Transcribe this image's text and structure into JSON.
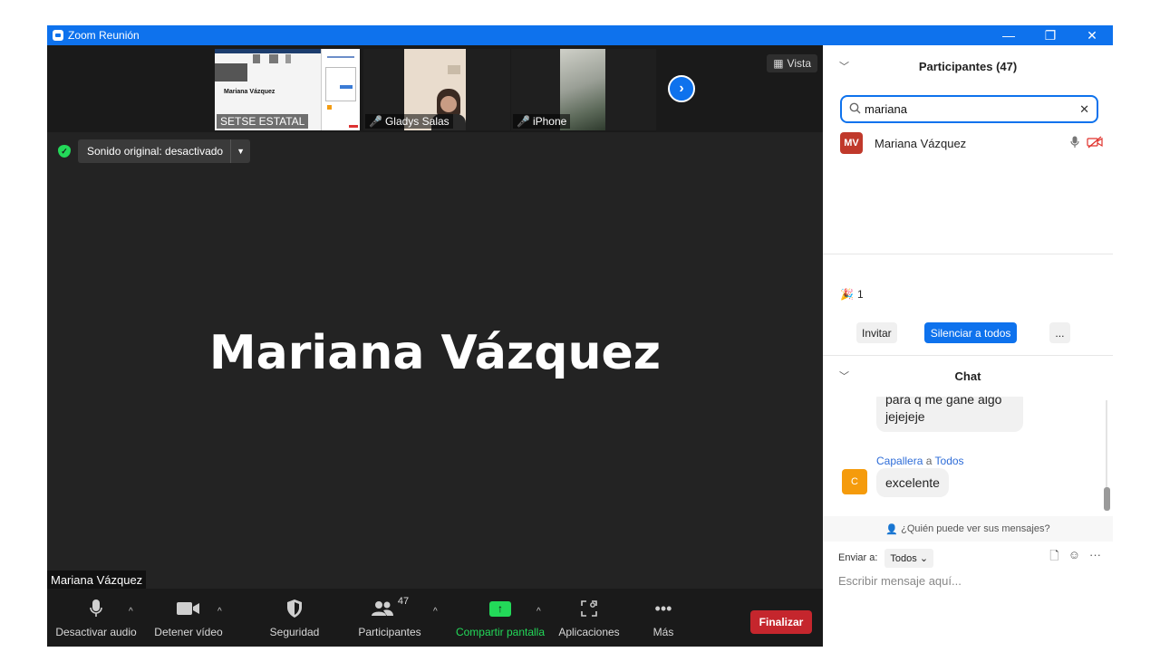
{
  "window": {
    "title": "Zoom Reunión",
    "controls": {
      "minimize": "—",
      "restore": "❐",
      "close": "✕"
    }
  },
  "strip": {
    "thumbnails": [
      {
        "label": "SETSE ESTATAL",
        "inner_name": "Mariana Vázquez",
        "muted": false
      },
      {
        "label": "Gladys Salas",
        "muted": true
      },
      {
        "label": "iPhone",
        "muted": true
      }
    ],
    "next_icon": "chevron-right-icon",
    "view_label": "Vista"
  },
  "sound": {
    "label": "Sonido original: desactivado",
    "shield_ok": "✓"
  },
  "speaker": {
    "big_name": "Mariana Vázquez",
    "name_tag": "Mariana Vázquez"
  },
  "toolbar": {
    "audio": "Desactivar audio",
    "video": "Detener vídeo",
    "security": "Seguridad",
    "participants": "Participantes",
    "participants_count": "47",
    "share": "Compartir pantalla",
    "apps": "Aplicaciones",
    "more": "Más",
    "end": "Finalizar"
  },
  "participants_panel": {
    "title": "Participantes (47)",
    "search_value": "mariana",
    "results": [
      {
        "initials": "MV",
        "name": "Mariana Vázquez",
        "avatar_color": "#c0392b"
      }
    ],
    "reaction_count": "1",
    "invite": "Invitar",
    "mute_all": "Silenciar a todos",
    "more": "..."
  },
  "chat": {
    "title": "Chat",
    "prev_message": [
      "para q me gane algo",
      "jejejeje"
    ],
    "sender": "Capallera",
    "to_word": "a",
    "recipient": "Todos",
    "sender_initial": "C",
    "message": "excelente",
    "who_sees": "¿Quién puede ver sus mensajes?",
    "send_to_label": "Enviar a:",
    "send_to_value": "Todos",
    "input_placeholder": "Escribir mensaje aquí..."
  },
  "colors": {
    "accent": "#0e72ed",
    "end": "#c5262d",
    "share": "#23d959",
    "avatar_mv": "#c0392b",
    "avatar_c": "#f59b0c"
  }
}
